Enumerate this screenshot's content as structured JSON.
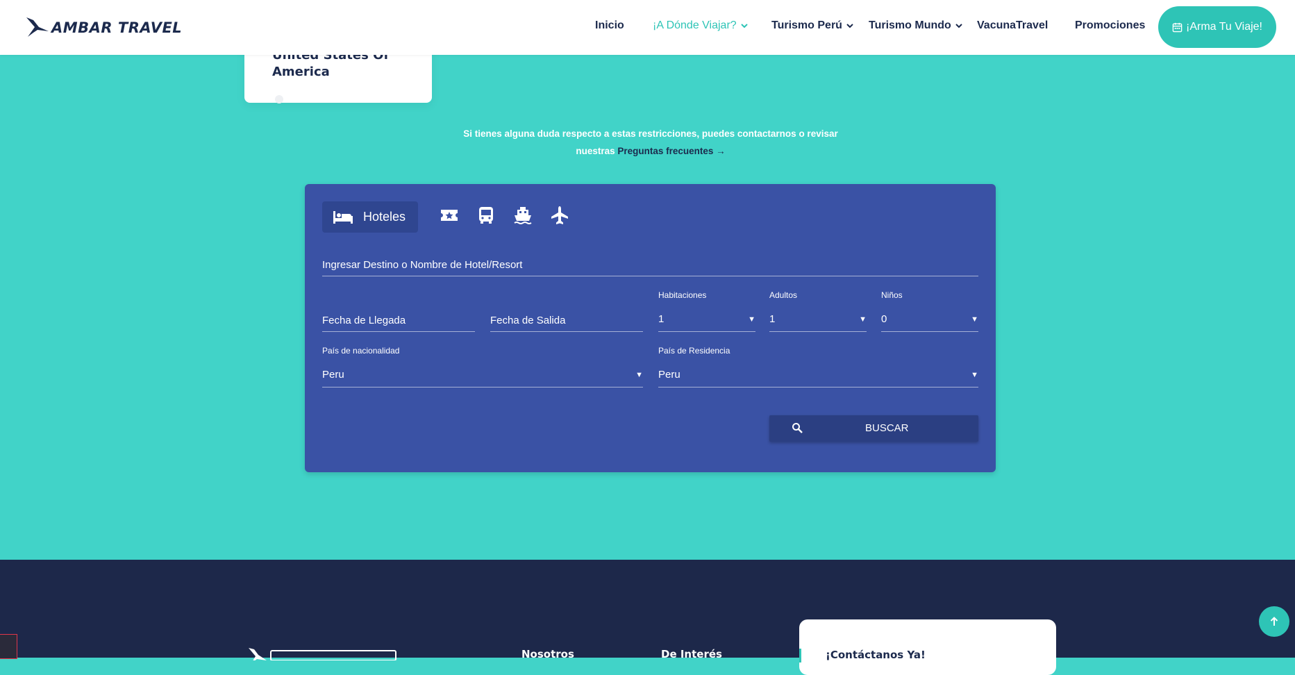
{
  "brand": {
    "name": "AMBAR TRAVEL",
    "accent": "#2ec4b6",
    "navy": "#1c2a4d",
    "panel": "#3a52a5"
  },
  "nav": {
    "items": [
      {
        "label": "Inicio"
      },
      {
        "label": "¡A Dónde Viajar?"
      },
      {
        "label": "Turismo Perú"
      },
      {
        "label": "Turismo Mundo"
      },
      {
        "label": "VacunaTravel"
      },
      {
        "label": "Promociones"
      }
    ],
    "cta": "¡Arma Tu Viaje!"
  },
  "country_card": {
    "name": "United States Of America"
  },
  "notice": {
    "text": "Si tienes alguna duda respecto a estas restricciones, puedes contactarnos o revisar nuestras",
    "link": "Preguntas frecuentes →"
  },
  "search": {
    "active_tab": "Hoteles",
    "tabs_icons": [
      "bed-icon",
      "ticket-icon",
      "bus-icon",
      "ship-icon",
      "airplane-icon"
    ],
    "destination_placeholder": "Ingresar Destino o Nombre de Hotel/Resort",
    "checkin_placeholder": "Fecha de Llegada",
    "checkout_placeholder": "Fecha de Salida",
    "rooms": {
      "label": "Habitaciones",
      "value": "1"
    },
    "adults": {
      "label": "Adultos",
      "value": "1"
    },
    "children": {
      "label": "Niños",
      "value": "0"
    },
    "nationality": {
      "label": "País de nacionalidad",
      "value": "Peru"
    },
    "residence": {
      "label": "País de Residencia",
      "value": "Peru"
    },
    "button": "BUSCAR"
  },
  "footer": {
    "col1": "Nosotros",
    "col2": "De Interés",
    "contact_title": "¡Contáctanos Ya!"
  }
}
